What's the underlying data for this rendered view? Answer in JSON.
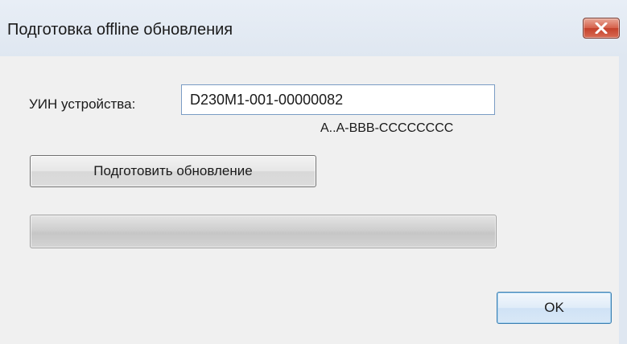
{
  "window": {
    "title": "Подготовка offline обновления",
    "close_icon": "close-x-icon",
    "accent_close": "#c4412b"
  },
  "form": {
    "uin_label": "УИН устройства:",
    "uin_value": "D230M1-001-00000082",
    "uin_format_hint": "A..A-BBB-CCCCCCCC",
    "prepare_button_label": "Подготовить обновление",
    "progress_value": 0
  },
  "footer": {
    "ok_button_label": "OK"
  }
}
